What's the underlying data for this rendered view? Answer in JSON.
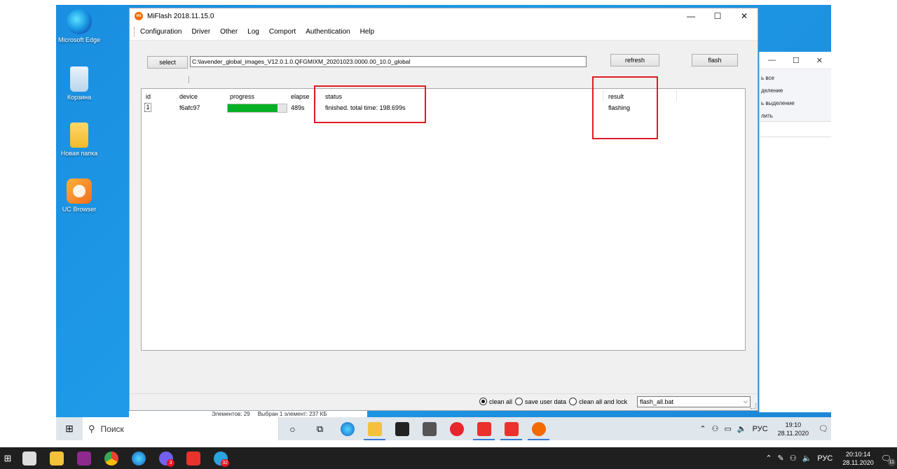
{
  "desktop": {
    "icons": [
      {
        "label": "Microsoft Edge",
        "icon": "edge-icon"
      },
      {
        "label": "Корзина",
        "icon": "recycle-bin-icon"
      },
      {
        "label": "Новая папка",
        "icon": "folder-icon"
      },
      {
        "label": "UC Browser",
        "icon": "uc-browser-icon"
      }
    ]
  },
  "background_window": {
    "title_buttons": [
      "—",
      "☐",
      "✕"
    ],
    "ribbon_items": [
      "ь все",
      "деление",
      "ь выделение",
      "лить"
    ]
  },
  "miflash": {
    "title": "MiFlash 2018.11.15.0",
    "logo_text": "mi",
    "window_buttons": [
      "—",
      "☐",
      "✕"
    ],
    "menu": [
      "Configuration",
      "Driver",
      "Other",
      "Log",
      "Comport",
      "Authentication",
      "Help"
    ],
    "select_label": "select",
    "path_value": "C:\\lavender_global_images_V12.0.1.0.QFGMIXM_20201023.0000.00_10.0_global",
    "refresh_label": "refresh",
    "flash_label": "flash",
    "columns": {
      "id": "id",
      "device": "device",
      "progress": "progress",
      "elapse": "elapse",
      "status": "status",
      "result": "result"
    },
    "rows": [
      {
        "id": "1",
        "device": "f6afc97",
        "progress": 0.85,
        "elapse": "489s",
        "status": "finished. total time: 198.699s",
        "result": "flashing"
      }
    ],
    "options": [
      "clean all",
      "save user data",
      "clean all and lock"
    ],
    "selected_option": "clean all",
    "script": "flash_all.bat"
  },
  "explorer_status": {
    "items": "Элементов: 29",
    "selected": "Выбран 1 элемент: 237 КБ"
  },
  "inner_taskbar": {
    "search_placeholder": "Поиск",
    "tray_lang": "РУС",
    "time": "19:10",
    "date": "28.11.2020"
  },
  "outer_taskbar": {
    "badges": {
      "viber": "3",
      "telegram": "32"
    },
    "tray_lang": "РУС",
    "time": "20:10:14",
    "date": "28.11.2020",
    "notification_count": "11"
  },
  "colors": {
    "progress_fill": "#06b025",
    "highlight_box": "#e01b24",
    "desktop_bg": "#1a8ee0",
    "mi_orange": "#f56a00"
  }
}
